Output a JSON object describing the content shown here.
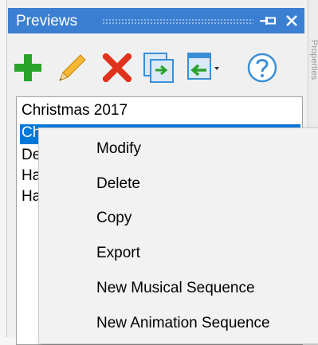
{
  "panel": {
    "title": "Previews",
    "side_strip_text": "Properties"
  },
  "toolbar": {
    "buttons": [
      {
        "name": "add",
        "icon": "plus-icon",
        "color": "#2aa32a"
      },
      {
        "name": "edit",
        "icon": "pencil-icon",
        "color": "#f2a12a"
      },
      {
        "name": "delete",
        "icon": "x-icon",
        "color": "#e0321c"
      },
      {
        "name": "copy",
        "icon": "copy-icon",
        "color": "#3a8fd6"
      },
      {
        "name": "export",
        "icon": "export-icon",
        "color": "#3a8fd6"
      },
      {
        "name": "help",
        "icon": "question-icon",
        "color": "#3a8fd6"
      }
    ]
  },
  "list": {
    "items": [
      "Christmas 2017",
      "Ch",
      "De",
      "Ha",
      "Ha"
    ],
    "selected_index": 1
  },
  "context_menu": {
    "items": [
      "Modify",
      "Delete",
      "Copy",
      "Export",
      "New Musical Sequence",
      "New Animation Sequence"
    ]
  },
  "colors": {
    "title_bar": "#3a7fd2",
    "selection": "#0078d7"
  }
}
